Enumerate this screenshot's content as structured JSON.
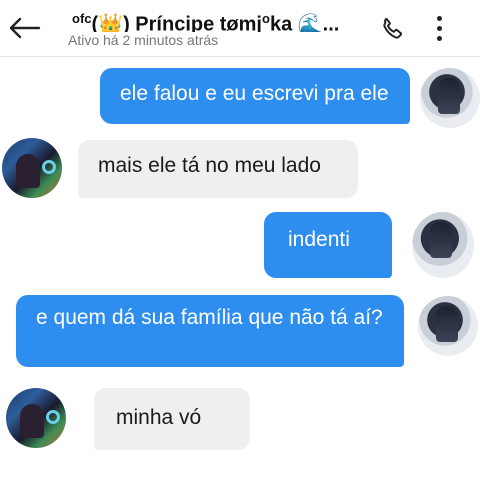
{
  "header": {
    "title_prefix": "ofc",
    "title_emoji_crown": "👑",
    "title_name": "Príncipe tømj",
    "title_sup": "o",
    "title_name_end": "ka",
    "title_emoji_wave": "🌊",
    "title_ellipsis": "...",
    "subtitle": "Ativo há 2 minutos atrás",
    "icons": {
      "back": "arrow-left-icon",
      "call": "phone-icon",
      "menu": "more-vert-icon"
    }
  },
  "messages": [
    {
      "id": "m1",
      "direction": "outgoing",
      "text": "ele falou e eu escrevi pra ele"
    },
    {
      "id": "m2",
      "direction": "incoming",
      "text": "mais ele tá no meu lado"
    },
    {
      "id": "m3",
      "direction": "outgoing",
      "text": "indenti"
    },
    {
      "id": "m4",
      "direction": "outgoing",
      "text": "e quem dá sua família que não tá aí?"
    },
    {
      "id": "m5",
      "direction": "incoming",
      "text": "minha vó"
    }
  ],
  "colors": {
    "outgoing_bubble": "#2e8ef0",
    "incoming_bubble": "#efefef",
    "subtitle": "#777777"
  }
}
